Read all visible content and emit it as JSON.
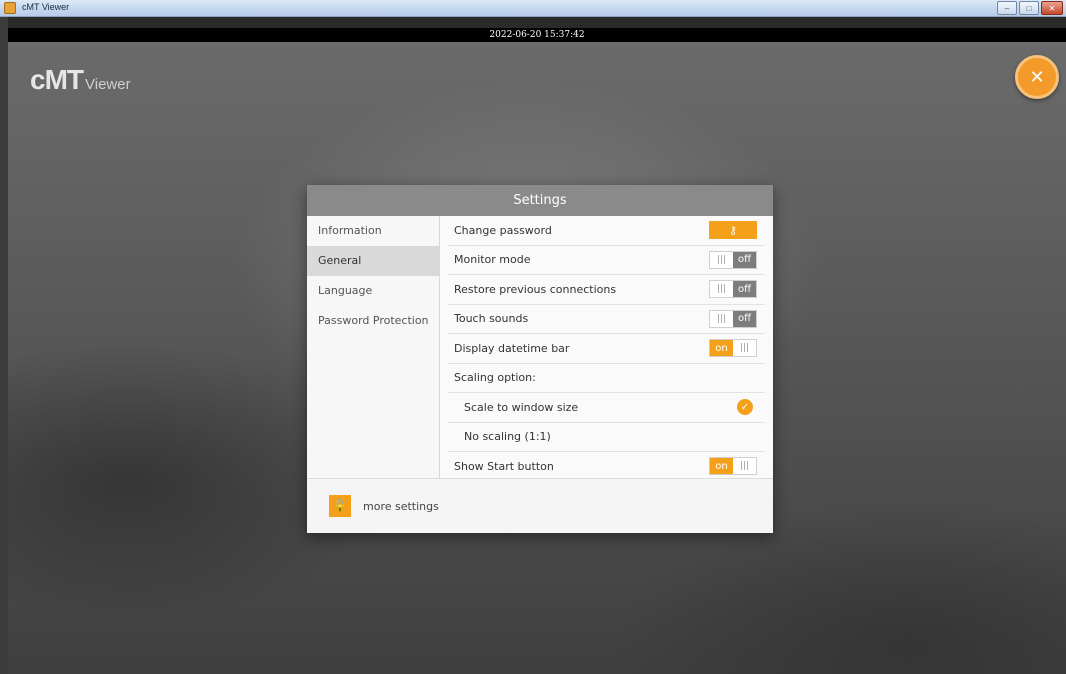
{
  "window": {
    "title": "cMT Viewer",
    "min_label": "–",
    "max_label": "□",
    "close_label": "✕"
  },
  "datetime_bar": "2022-06-20 15:37:42",
  "logo": {
    "main": "cMT",
    "sub": "Viewer"
  },
  "close_fab_label": "✕",
  "dialog": {
    "title": "Settings",
    "nav": [
      {
        "label": "Information",
        "active": false
      },
      {
        "label": "General",
        "active": true
      },
      {
        "label": "Language",
        "active": false
      },
      {
        "label": "Password Protection",
        "active": false
      }
    ],
    "settings": {
      "change_password": {
        "label": "Change password",
        "icon": "key-icon",
        "glyph": "⚷"
      },
      "monitor_mode": {
        "label": "Monitor mode",
        "state": "off"
      },
      "restore_connections": {
        "label": "Restore previous connections",
        "state": "off"
      },
      "touch_sounds": {
        "label": "Touch sounds",
        "state": "off"
      },
      "display_datetime_bar": {
        "label": "Display datetime bar",
        "state": "on"
      },
      "scaling_option": {
        "label": "Scaling option:"
      },
      "scale_to_window": {
        "label": "Scale to window size",
        "selected": true
      },
      "no_scaling": {
        "label": "No scaling (1:1)",
        "selected": false
      },
      "show_start_button": {
        "label": "Show Start button",
        "state": "on"
      }
    },
    "toggle_grip": "|||",
    "footer": {
      "label": "more settings",
      "icon": "lock-icon",
      "glyph": "🔓"
    }
  },
  "colors": {
    "accent": "#f5a019",
    "toggle_off": "#7d7d7d",
    "header": "#8a8a8a"
  }
}
